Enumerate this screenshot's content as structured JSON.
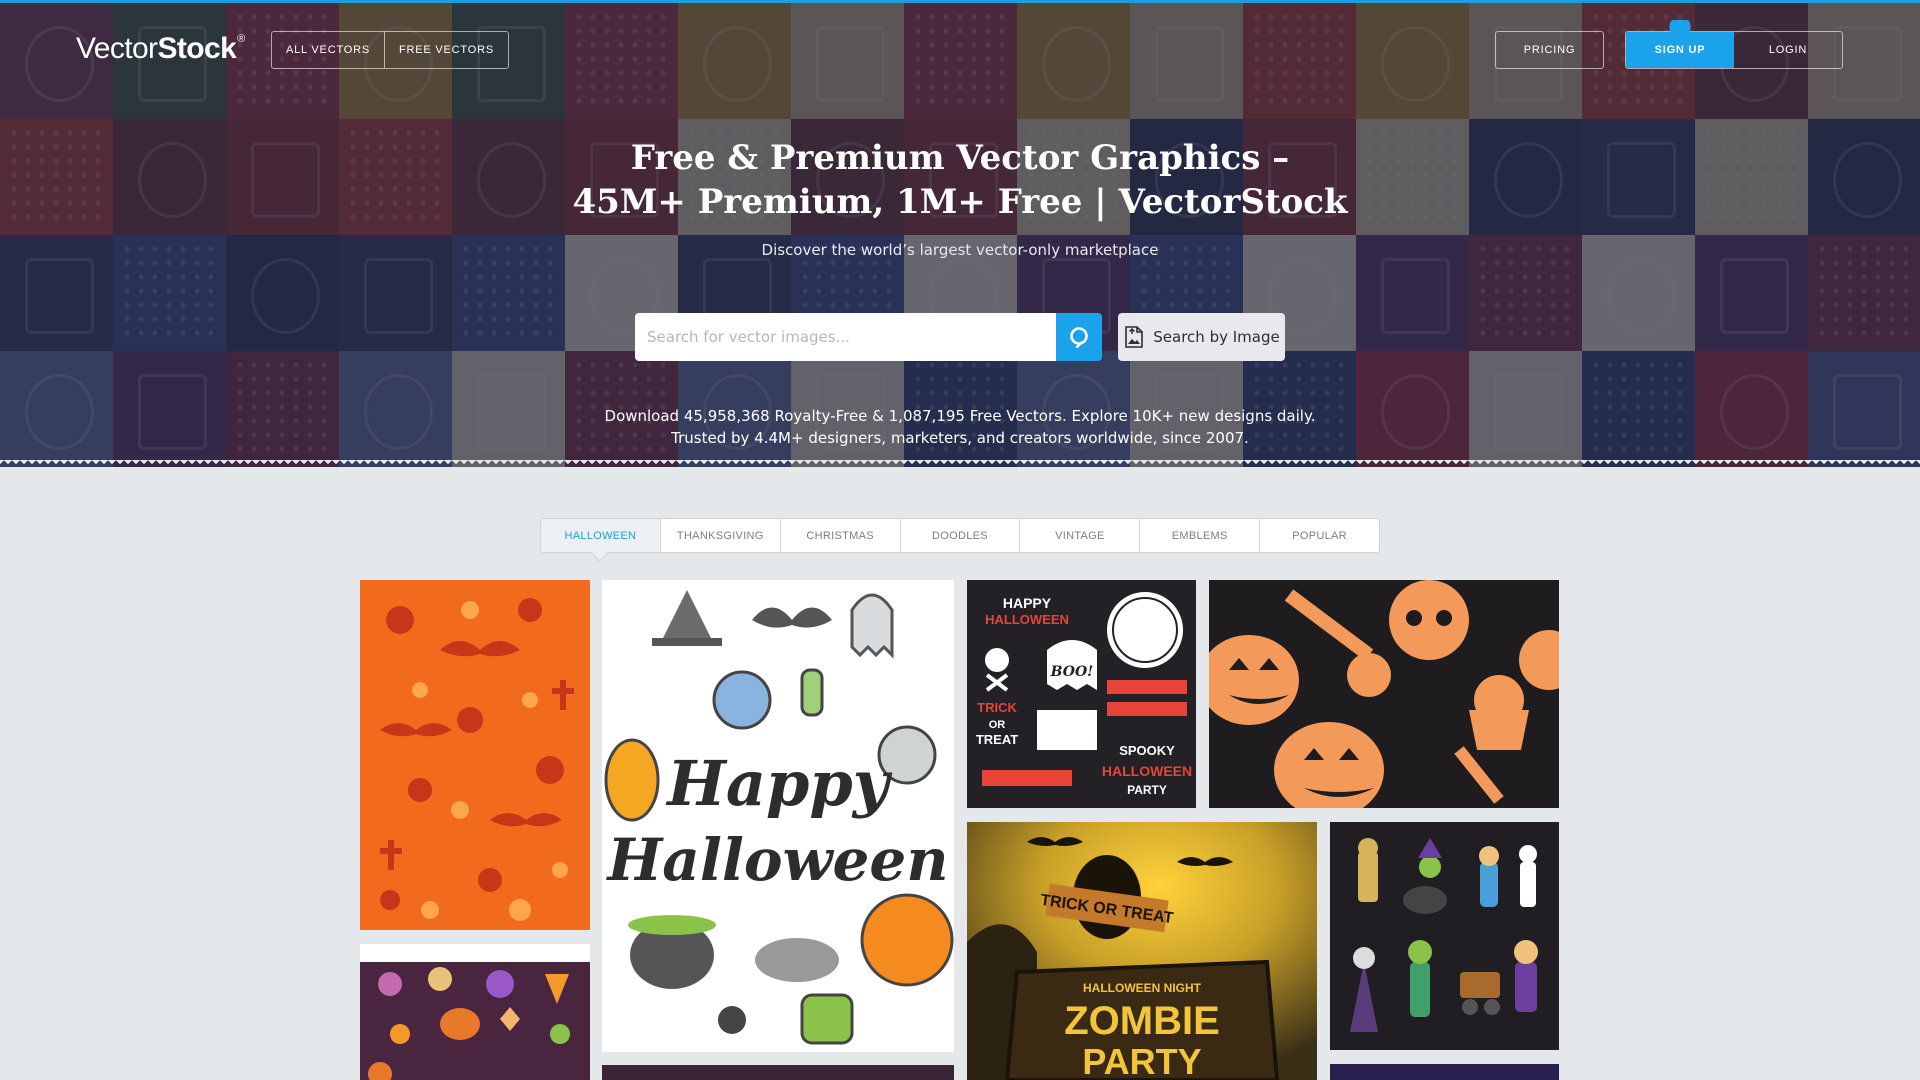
{
  "header": {
    "logo_part1": "Vector",
    "logo_part2": "Stock",
    "logo_mark": "®",
    "nav": [
      "ALL VECTORS",
      "FREE VECTORS"
    ],
    "pricing": "PRICING",
    "signup": "SIGN UP",
    "login": "LOGIN"
  },
  "hero": {
    "title_line1": "Free & Premium Vector Graphics –",
    "title_line2": "45M+ Premium, 1M+ Free | VectorStock",
    "subtitle": "Discover the world’s largest vector-only marketplace",
    "search_placeholder": "Search for vector images...",
    "search_by_image": "Search by Image",
    "stats_line1": "Download 45,958,368 Royalty-Free & 1,087,195 Free Vectors. Explore 10K+ new designs daily.",
    "stats_line2": "Trusted by 4.4M+ designers, marketers, and creators worldwide, since 2007."
  },
  "tabs": [
    "HALLOWEEN",
    "THANKSGIVING",
    "CHRISTMAS",
    "DOODLES",
    "VINTAGE",
    "EMBLEMS",
    "POPULAR"
  ],
  "active_tab": "HALLOWEEN",
  "gallery": {
    "card_set_texts": [
      "HAPPY",
      "HALLOWEEN",
      "TRICK",
      "OR",
      "TREAT",
      "BOO!",
      "SPOOKY",
      "HALLOWEEN",
      "PARTY"
    ],
    "card_lettering": [
      "Happy",
      "Halloween"
    ],
    "card_poster": [
      "TRICK OR TREAT",
      "HALLOWEEN NIGHT",
      "ZOMBIE",
      "PARTY"
    ]
  },
  "colors": {
    "accent": "#1aa3ea",
    "page_bg": "#e4e8ea",
    "hero_overlay": "#22243c",
    "orange": "#f26b1d",
    "dark": "#1e1c1f"
  },
  "icons": [
    "search-icon",
    "image-upload-icon"
  ]
}
